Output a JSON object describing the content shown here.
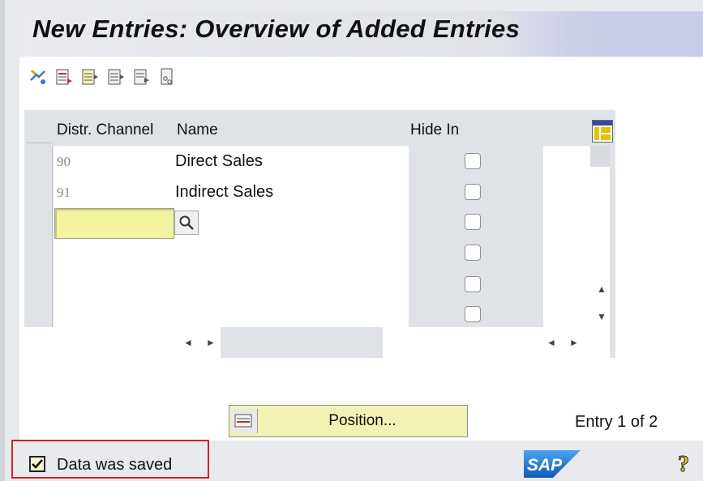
{
  "window": {
    "title": "New Entries: Overview of Added Entries"
  },
  "toolbar": {
    "buttons": [
      {
        "icon": "display-change-icon"
      },
      {
        "icon": "new-entries-icon"
      },
      {
        "icon": "copy-as-icon"
      },
      {
        "icon": "delete-icon"
      },
      {
        "icon": "undo-change-icon"
      },
      {
        "icon": "select-all-icon"
      }
    ]
  },
  "table": {
    "headers": {
      "dist_channel": "Distr. Channel",
      "name": "Name",
      "hide_in": "Hide In"
    },
    "rows": [
      {
        "code": "90",
        "name": "Direct Sales",
        "hide": false
      },
      {
        "code": "91",
        "name": "Indirect Sales",
        "hide": false
      },
      {
        "code": "",
        "name": "",
        "hide": false
      },
      {
        "code": "",
        "name": "",
        "hide": false
      },
      {
        "code": "",
        "name": "",
        "hide": false
      },
      {
        "code": "",
        "name": "",
        "hide": false
      }
    ]
  },
  "position_button": {
    "label": "Position..."
  },
  "entry_info": "Entry 1 of 2",
  "status": {
    "message": "Data was saved"
  },
  "colors": {
    "input_highlight": "#f3f3a0",
    "status_border": "#c8252b",
    "sap_blue": "#1e6fc8"
  }
}
